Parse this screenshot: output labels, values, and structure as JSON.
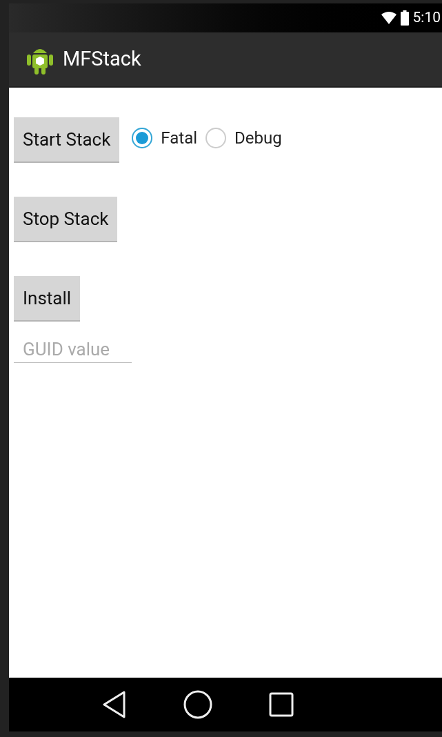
{
  "status_bar": {
    "time": "5:10"
  },
  "action_bar": {
    "title": "MFStack"
  },
  "rows": [
    {
      "button": "Start Stack",
      "radios": [
        {
          "label": "Fatal",
          "selected": true
        },
        {
          "label": "Debug",
          "selected": false
        }
      ]
    },
    {
      "button": "Stop Stack"
    },
    {
      "button": "Install"
    }
  ],
  "guid_field": {
    "placeholder": "GUID value"
  }
}
